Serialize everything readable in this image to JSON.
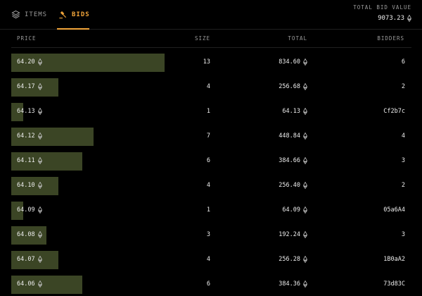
{
  "tabs": [
    {
      "label": "ITEMS",
      "icon": "layers-icon",
      "active": false
    },
    {
      "label": "BIDS",
      "icon": "gavel-icon",
      "active": true
    }
  ],
  "summary": {
    "label": "TOTAL BID VALUE",
    "value": "9073.23",
    "icon": "eth-icon"
  },
  "table": {
    "columns": [
      "PRICE",
      "SIZE",
      "TOTAL",
      "BIDDERS"
    ],
    "max_size": 13,
    "rows": [
      {
        "price": "64.20",
        "size": "13",
        "total": "834.60",
        "bidders": "6"
      },
      {
        "price": "64.17",
        "size": "4",
        "total": "256.68",
        "bidders": "2"
      },
      {
        "price": "64.13",
        "size": "1",
        "total": "64.13",
        "bidders": "Cf2b7c"
      },
      {
        "price": "64.12",
        "size": "7",
        "total": "448.84",
        "bidders": "4"
      },
      {
        "price": "64.11",
        "size": "6",
        "total": "384.66",
        "bidders": "3"
      },
      {
        "price": "64.10",
        "size": "4",
        "total": "256.40",
        "bidders": "2"
      },
      {
        "price": "64.09",
        "size": "1",
        "total": "64.09",
        "bidders": "05a6A4"
      },
      {
        "price": "64.08",
        "size": "3",
        "total": "192.24",
        "bidders": "3"
      },
      {
        "price": "64.07",
        "size": "4",
        "total": "256.28",
        "bidders": "1B0aA2"
      },
      {
        "price": "64.06",
        "size": "6",
        "total": "384.36",
        "bidders": "73d83C"
      }
    ]
  },
  "colors": {
    "accent": "#f2a53a",
    "bar": "#3b4525",
    "background": "#000000"
  }
}
